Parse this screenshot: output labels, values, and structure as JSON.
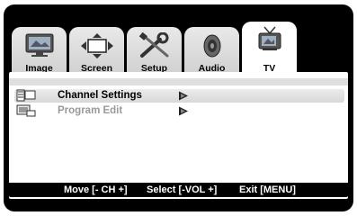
{
  "tabs": [
    {
      "label": "Image",
      "icon": "monitor-icon",
      "active": false
    },
    {
      "label": "Screen",
      "icon": "screen-arrows-icon",
      "active": false
    },
    {
      "label": "Setup",
      "icon": "wrench-screwdriver-icon",
      "active": false
    },
    {
      "label": "Audio",
      "icon": "speaker-icon",
      "active": false
    },
    {
      "label": "TV",
      "icon": "tv-antenna-icon",
      "active": true
    }
  ],
  "menu": {
    "items": [
      {
        "label": "Channel Settings",
        "icon": "channel-list-icon",
        "selected": true,
        "enabled": true
      },
      {
        "label": "Program Edit",
        "icon": "program-edit-icon",
        "selected": false,
        "enabled": false
      }
    ]
  },
  "hints": {
    "move": "Move [- CH +]",
    "select": "Select [-VOL +]",
    "exit": "Exit [MENU]"
  },
  "colors": {
    "frame": "#000000",
    "tab_inactive": "#d9d9d9",
    "tab_active": "#ffffff",
    "disabled_text": "#9a9a9a"
  }
}
